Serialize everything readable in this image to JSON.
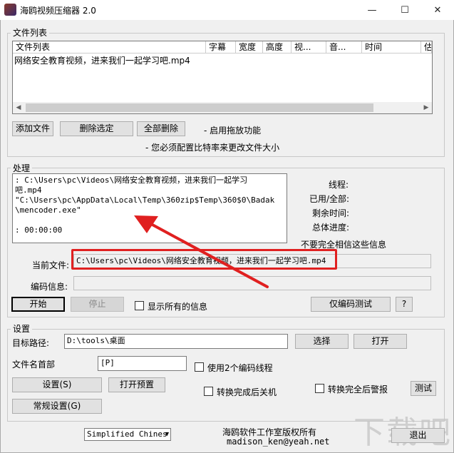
{
  "window": {
    "title": "海鸥视频压缩器 2.0",
    "minimize": "—",
    "maximize": "☐",
    "close": "✕"
  },
  "file_list": {
    "group_title": "文件列表",
    "columns": [
      "文件列表",
      "字幕",
      "宽度",
      "高度",
      "视...",
      "音...",
      "时间",
      "估"
    ],
    "rows": [
      "网络安全教育视频，进来我们一起学习吧.mp4"
    ],
    "add_button": "添加文件",
    "remove_button": "删除选定",
    "clear_button": "全部删除",
    "drag_hint": "- 启用拖放功能",
    "bitrate_hint": "- 您必须配置比特率来更改文件大小"
  },
  "processing": {
    "group_title": "处理",
    "log_lines": [
      " : C:\\Users\\pc\\Videos\\网络安全教育视频，进来我们一起学习",
      "吧.mp4",
      "\"C:\\Users\\pc\\AppData\\Local\\Temp\\360zip$Temp\\360$0\\Badak",
      "\\mencoder.exe\"",
      "",
      " : 00:00:00"
    ],
    "thread_label": "线程:",
    "used_total_label": "已用/全部:",
    "remaining_label": "剩余时间:",
    "overall_label": "总体进度:",
    "warning": "不要完全相信这些信息",
    "current_file_label": "当前文件:",
    "current_file_value": "C:\\Users\\pc\\Videos\\网络安全教育视频，进来我们一起学习吧.mp4",
    "encode_info_label": "编码信息:",
    "encode_info_value": "",
    "start_button": "开始",
    "stop_button": "停止",
    "show_all_label": "显示所有的信息",
    "test_encode_button": "仅编码测试",
    "help_button": "?"
  },
  "settings": {
    "group_title": "设置",
    "target_path_label": "目标路径:",
    "target_path_value": "D:\\tools\\桌面",
    "choose_button": "选择",
    "open_button": "打开",
    "filename_prefix_label": "文件名首部",
    "filename_prefix_value": "[P]",
    "two_threads_label": "使用2个编码线程",
    "settings_button": "设置(S)",
    "open_preset_button": "打开预置",
    "shutdown_label": "转换完成后关机",
    "alarm_label": "转换完全后警报",
    "test_button": "测试",
    "general_settings_button": "常规设置(G)"
  },
  "footer": {
    "language_value": "Simplified Chines",
    "copyright": "海鸥软件工作室版权所有",
    "email": "madison_ken@yeah.net",
    "exit_button": "退出",
    "watermark": "下载吧"
  },
  "annotation_color": "#e02020"
}
